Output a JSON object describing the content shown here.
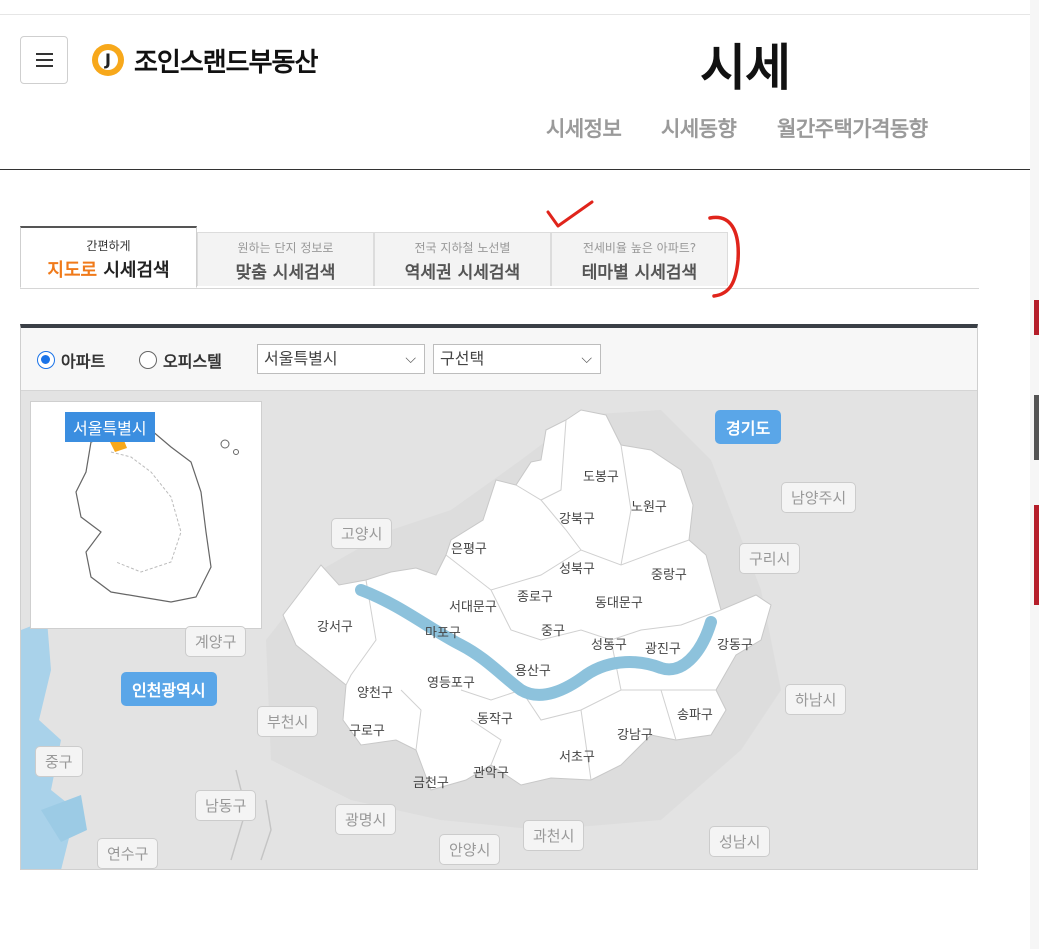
{
  "header": {
    "logo_text": "조인스랜드부동산",
    "logo_mark": "J",
    "page_title": "시세",
    "subnav": [
      "시세정보",
      "시세동향",
      "월간주택가격동향"
    ]
  },
  "tabs": [
    {
      "small": "간편하게",
      "big_a": "지도로",
      "big_b": " 시세검색",
      "active": true
    },
    {
      "small": "원하는 단지 정보로",
      "big": "맞춤 시세검색",
      "active": false
    },
    {
      "small": "전국 지하철 노선별",
      "big": "역세권 시세검색",
      "active": false
    },
    {
      "small": "전세비율 높은 아파트?",
      "big": "테마별 시세검색",
      "active": false
    }
  ],
  "filters": {
    "radio_apartment": "아파트",
    "radio_office": "오피스텔",
    "selected_type": "아파트",
    "city_select": "서울특별시",
    "district_select": "구선택"
  },
  "map": {
    "inset_label": "서울특별시",
    "districts": [
      "도봉구",
      "노원구",
      "강북구",
      "은평구",
      "성북구",
      "중랑구",
      "종로구",
      "서대문구",
      "동대문구",
      "강서구",
      "마포구",
      "중구",
      "성동구",
      "광진구",
      "강동구",
      "용산구",
      "양천구",
      "영등포구",
      "구로구",
      "동작구",
      "송파구",
      "강남구",
      "서초구",
      "금천구",
      "관악구"
    ],
    "outer_areas": [
      "고양시",
      "남양주시",
      "구리시",
      "계양구",
      "부천시",
      "하남시",
      "중구",
      "남동구",
      "광명시",
      "과천시",
      "성남시",
      "연수구",
      "안양시"
    ],
    "region_badges": [
      "경기도",
      "인천광역시"
    ]
  },
  "colors": {
    "accent_orange": "#f07a1a",
    "river": "#8dc2dc",
    "badge_blue": "#5aa6e8",
    "annotation_red": "#e0241b"
  }
}
